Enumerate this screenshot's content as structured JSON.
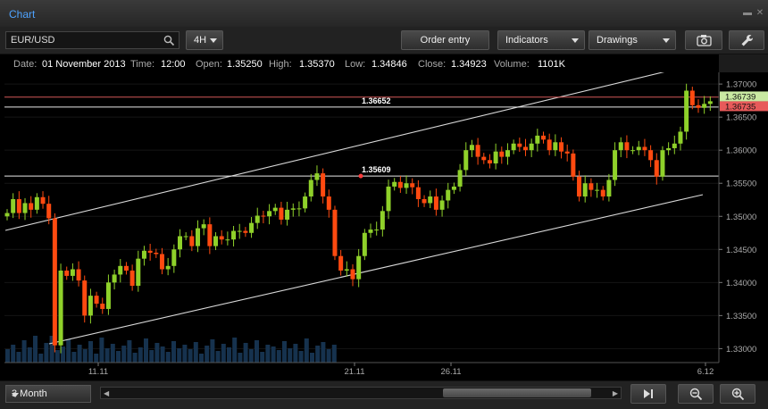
{
  "window": {
    "title": "Chart"
  },
  "toolbar": {
    "symbol": "EUR/USD",
    "timeframe": "4H",
    "order_entry_label": "Order entry",
    "indicators_label": "Indicators",
    "drawings_label": "Drawings"
  },
  "info": {
    "date_label": "Date:",
    "date": "01 November 2013",
    "time_label": "Time:",
    "time": "12:00",
    "open_label": "Open:",
    "open": "1.35250",
    "high_label": "High:",
    "high": "1.35370",
    "low_label": "Low:",
    "low": "1.34846",
    "close_label": "Close:",
    "close": "1.34923",
    "volume_label": "Volume:",
    "volume": "1101K"
  },
  "bottom": {
    "range_label": "3 Month"
  },
  "colors": {
    "up": "#8fd12a",
    "down": "#ff4a10",
    "volume": "#16324e",
    "bid": "#c9e9a2",
    "ask": "#e85a5a"
  },
  "chart_data": {
    "type": "candlestick",
    "y_ticks": [
      "1.37000",
      "1.36500",
      "1.36000",
      "1.35500",
      "1.35000",
      "1.34500",
      "1.34000",
      "1.33500",
      "1.33000"
    ],
    "x_ticks": [
      "11.11",
      "21.11",
      "26.11",
      "6.12"
    ],
    "ylim": [
      1.3283,
      1.3715
    ],
    "price_tags": {
      "bid": "1.36739",
      "ask": "1.36735"
    },
    "horizontal_lines": [
      {
        "label": "1.36652",
        "value": 1.36652
      },
      {
        "label": "1.35609",
        "value": 1.35609
      }
    ],
    "closes": [
      1.3505,
      1.3526,
      1.3505,
      1.352,
      1.351,
      1.3529,
      1.3519,
      1.3497,
      1.3305,
      1.3418,
      1.341,
      1.342,
      1.3403,
      1.335,
      1.338,
      1.3368,
      1.336,
      1.34,
      1.3412,
      1.3425,
      1.3418,
      1.3395,
      1.3436,
      1.3448,
      1.3445,
      1.3443,
      1.342,
      1.3425,
      1.345,
      1.347,
      1.347,
      1.3455,
      1.3482,
      1.3488,
      1.3455,
      1.347,
      1.3465,
      1.3465,
      1.3478,
      1.3478,
      1.3475,
      1.349,
      1.3501,
      1.35,
      1.3508,
      1.3513,
      1.3495,
      1.351,
      1.3512,
      1.3512,
      1.353,
      1.3555,
      1.3565,
      1.353,
      1.351,
      1.344,
      1.3418,
      1.342,
      1.3405,
      1.344,
      1.3475,
      1.348,
      1.348,
      1.3508,
      1.3545,
      1.3552,
      1.3543,
      1.355,
      1.3544,
      1.3526,
      1.352,
      1.353,
      1.351,
      1.3524,
      1.354,
      1.3545,
      1.357,
      1.36,
      1.3608,
      1.359,
      1.3585,
      1.358,
      1.3598,
      1.359,
      1.36,
      1.361,
      1.3605,
      1.36,
      1.361,
      1.3622,
      1.3616,
      1.36,
      1.3612,
      1.3598,
      1.3595,
      1.356,
      1.353,
      1.355,
      1.354,
      1.354,
      1.353,
      1.3555,
      1.36,
      1.3612,
      1.36,
      1.36,
      1.3605,
      1.36,
      1.3585,
      1.356,
      1.36,
      1.3603,
      1.361,
      1.3628,
      1.369,
      1.3668,
      1.3664,
      1.367,
      1.3674
    ],
    "volume": [
      15,
      20,
      12,
      25,
      17,
      30,
      10,
      22,
      30,
      14,
      18,
      26,
      12,
      20,
      15,
      24,
      10,
      28,
      16,
      21,
      13,
      19,
      25,
      11,
      17,
      27,
      14,
      22,
      18,
      12,
      24,
      16,
      20,
      15,
      23,
      10,
      19,
      26,
      13,
      21,
      17,
      28,
      11,
      22,
      15,
      25,
      12,
      20,
      18,
      14,
      24,
      16,
      21,
      13,
      27,
      11,
      19,
      23,
      15,
      20
    ]
  }
}
